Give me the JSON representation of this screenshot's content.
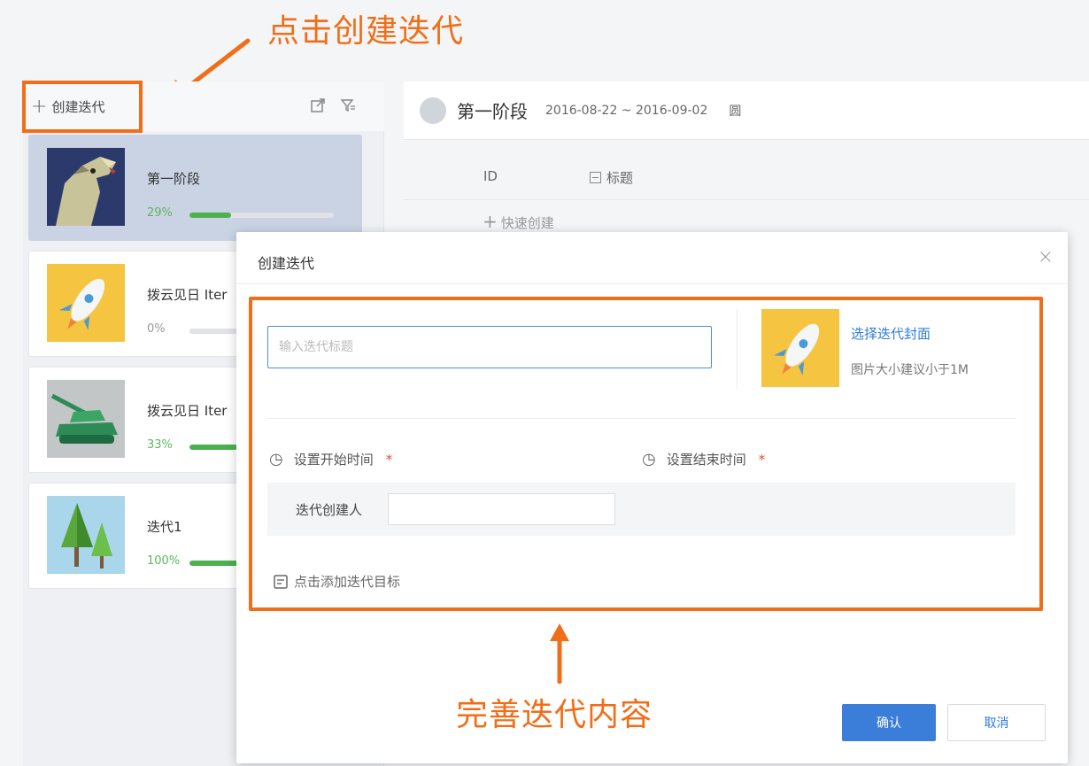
{
  "annotations": {
    "top": "点击创建迭代",
    "bottom": "完善迭代内容",
    "accent_color": "#f26d18"
  },
  "sidebar": {
    "create_label": "创建迭代",
    "icons": [
      "export-icon",
      "filter-icon"
    ],
    "iterations": [
      {
        "name": "第一阶段",
        "percent": "29%",
        "progress": 0.29,
        "thumb": "wolf-icon",
        "active": true
      },
      {
        "name": "拨云见日 Iter",
        "percent": "0%",
        "progress": 0.0,
        "thumb": "rocket-icon",
        "active": false
      },
      {
        "name": "拨云见日 Iter",
        "percent": "33%",
        "progress": 0.33,
        "thumb": "tank-icon",
        "active": false
      },
      {
        "name": "迭代1",
        "percent": "100%",
        "progress": 1.0,
        "thumb": "tree-icon",
        "active": false
      }
    ]
  },
  "main": {
    "stage_title": "第一阶段",
    "stage_date": "2016-08-22 ~ 2016-09-02",
    "calendar_glyph": "圆",
    "col_id": "ID",
    "col_title": "标题",
    "quick_create": "快速创建"
  },
  "modal": {
    "title": "创建迭代",
    "close": "×",
    "title_placeholder": "输入迭代标题",
    "cover_link": "选择迭代封面",
    "cover_hint": "图片大小建议小于1M",
    "start_time": "设置开始时间",
    "end_time": "设置结束时间",
    "required_mark": "*",
    "creator_label": "迭代创建人",
    "add_goal": "点击添加迭代目标",
    "confirm": "确认",
    "cancel": "取消"
  }
}
